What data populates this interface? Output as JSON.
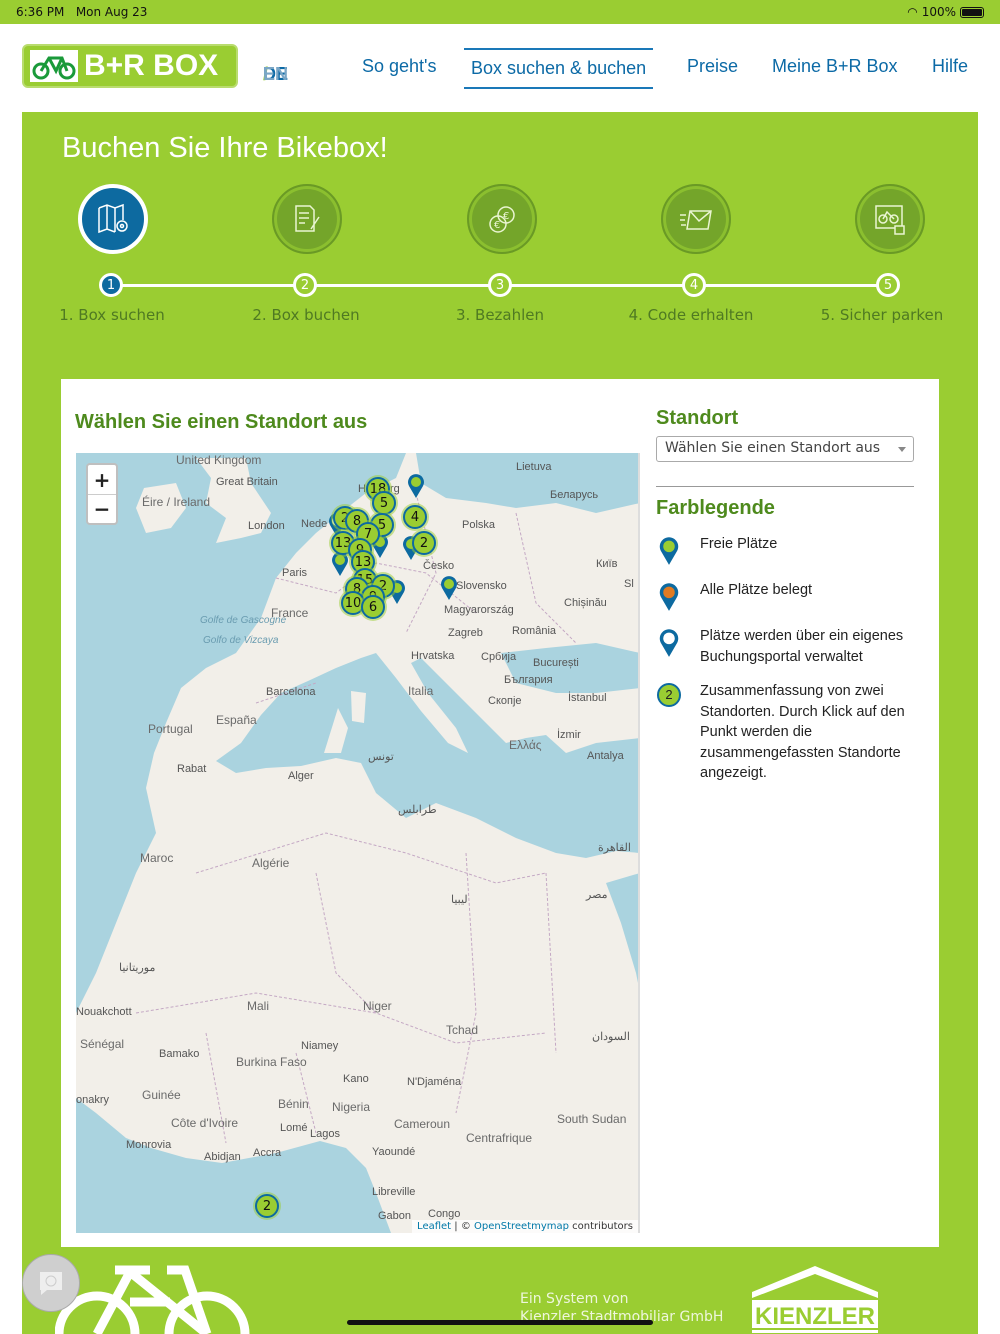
{
  "status": {
    "time": "6:36 PM",
    "date": "Mon Aug 23",
    "battery": "100%"
  },
  "header": {
    "logo": "B+R BOX",
    "lang_de": "DE",
    "lang_sep": "/",
    "lang_en": "EN",
    "nav": [
      "So geht's",
      "Box suchen & buchen",
      "Preise",
      "Meine B+R Box",
      "Hilfe"
    ]
  },
  "page_title": "Buchen Sie Ihre Bikebox!",
  "steps": [
    {
      "num": "1",
      "label": "1. Box suchen"
    },
    {
      "num": "2",
      "label": "2. Box buchen"
    },
    {
      "num": "3",
      "label": "3. Bezahlen"
    },
    {
      "num": "4",
      "label": "4. Code erhalten"
    },
    {
      "num": "5",
      "label": "5. Sicher parken"
    }
  ],
  "map_section": {
    "title": "Wählen Sie einen Standort aus",
    "zoom_in": "+",
    "zoom_out": "−",
    "attribution": {
      "leaflet": "Leaflet",
      "sep": " | © ",
      "osm": "OpenStreetmymap",
      "contributors": " contributors"
    },
    "clusters": [
      "18",
      "5",
      "2",
      "8",
      "5",
      "4",
      "7",
      "13",
      "9",
      "2",
      "13",
      "15",
      "8",
      "2",
      "9",
      "10",
      "6",
      "2"
    ],
    "labels": [
      "United Kingdom",
      "Great Britain",
      "Éire / Ireland",
      "London",
      "Nede",
      "Ha",
      "rg",
      "Lietuva",
      "Беларусь",
      "Polska",
      "Česko",
      "Slovensko",
      "Київ",
      "Chișinău",
      "Magyarország",
      "Zagreb",
      "România",
      "Paris",
      "France",
      "Golfe de Gascogne",
      "Golfo de Vizcaya",
      "Hrvatska",
      "Србија",
      "București",
      "България",
      "Barcelona",
      "España",
      "Portugal",
      "Italia",
      "Скопје",
      "İstanbul",
      "Ελλάς",
      "İzmir",
      "Antalya",
      "Rabat",
      "تونس",
      "Alger",
      "طرابلس",
      "Maroc",
      "Algérie",
      "ليبيا",
      "مصر",
      "القاهرة",
      "موريتانيا",
      "Mali",
      "Niger",
      "Tchad",
      "السودان",
      "Sénégal",
      "Bamako",
      "Burkina Faso",
      "Niamey",
      "Kano",
      "N'Djaména",
      "Guinée",
      "Bénin",
      "Nigeria",
      "Côte d'Ivoire",
      "Lomé",
      "Lagos",
      "Cameroun",
      "Monrovia",
      "Abidjan",
      "Accra",
      "Yaoundé",
      "Libreville",
      "Gabon",
      "Congo",
      "South Sudan",
      "Centrafrique",
      "onakry",
      "Nouakchott",
      "Sl"
    ]
  },
  "sidebar": {
    "standort_title": "Standort",
    "select_value": "Wählen Sie einen Standort aus",
    "legend_title": "Farblegende",
    "legend": [
      {
        "text": "Freie Plätze",
        "color": "#9acd32"
      },
      {
        "text": "Alle Plätze belegt",
        "color": "#e07b22"
      },
      {
        "text": "Plätze werden über ein eigenes Buchungsportal verwaltet",
        "color": "#ffffff"
      },
      {
        "text": "Zusammenfassung von zwei Standorten. Durch Klick auf den Punkt werden die zusammengefassten Standorte angezeigt.",
        "badge": "2"
      }
    ]
  },
  "footer": {
    "line1": "Ein System von",
    "line2": "Kienzler Stadtmobiliar GmbH",
    "logo": "KIENZLER"
  },
  "colors": {
    "green": "#9acd32",
    "blue": "#0d6aa0"
  }
}
